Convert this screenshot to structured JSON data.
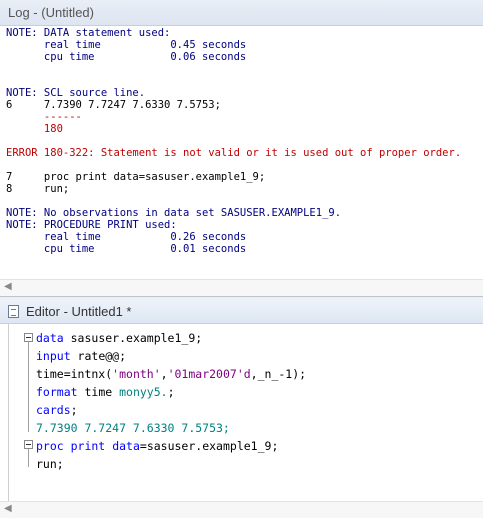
{
  "log": {
    "title": "Log - (Untitled)",
    "lines": [
      {
        "text": "NOTE: DATA statement used:",
        "cls": ""
      },
      {
        "text": "      real time           0.45 seconds",
        "cls": ""
      },
      {
        "text": "      cpu time            0.06 seconds",
        "cls": ""
      },
      {
        "text": "",
        "cls": ""
      },
      {
        "text": "",
        "cls": ""
      },
      {
        "text": "NOTE: SCL source line.",
        "cls": ""
      },
      {
        "text": "6     7.7390 7.7247 7.6330 7.5753;",
        "cls": "black"
      },
      {
        "text": "      ------",
        "cls": "red"
      },
      {
        "text": "      180",
        "cls": "red"
      },
      {
        "text": "",
        "cls": ""
      },
      {
        "text": "ERROR 180-322: Statement is not valid or it is used out of proper order.",
        "cls": "err"
      },
      {
        "text": "",
        "cls": ""
      },
      {
        "text": "7     proc print data=sasuser.example1_9;",
        "cls": "black"
      },
      {
        "text": "8     run;",
        "cls": "black"
      },
      {
        "text": "",
        "cls": ""
      },
      {
        "text": "NOTE: No observations in data set SASUSER.EXAMPLE1_9.",
        "cls": ""
      },
      {
        "text": "NOTE: PROCEDURE PRINT used:",
        "cls": ""
      },
      {
        "text": "      real time           0.26 seconds",
        "cls": ""
      },
      {
        "text": "      cpu time            0.01 seconds",
        "cls": ""
      }
    ]
  },
  "editor": {
    "title": "Editor - Untitled1 *",
    "code": {
      "l1_kw": "data",
      "l1_rest": " sasuser.example1_9;",
      "l2_kw": "input",
      "l2_rest": " rate@@;",
      "l3_a": "time=intnx(",
      "l3_str1": "'month'",
      "l3_b": ",",
      "l3_str2": "'01mar2007'd",
      "l3_c": ",_n_-1);",
      "l4_kw": "format",
      "l4_mid": " time ",
      "l4_fmt": "monyy5.",
      "l4_end": ";",
      "l5_kw": "cards",
      "l5_end": ";",
      "l6_data": "7.7390 7.7247 7.6330 7.5753;",
      "l7_kw1": "proc print",
      "l7_mid": " ",
      "l7_kw2": "data",
      "l7_rest": "=sasuser.example1_9;",
      "l8": "run;"
    }
  },
  "icons": {
    "log_scroll_left": "scroll-left-arrow-icon",
    "editor_doc": "document-icon",
    "fold": "fold-minus-icon"
  }
}
